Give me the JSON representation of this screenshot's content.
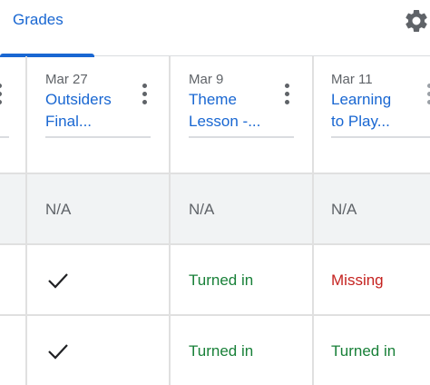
{
  "tab": {
    "label": "Grades"
  },
  "columns": [
    {
      "date": "Mar 27",
      "title_line1": "Outsiders",
      "title_line2": "Final..."
    },
    {
      "date": "Mar 9",
      "title_line1": "Theme",
      "title_line2": "Lesson -..."
    },
    {
      "date": "Mar 11",
      "title_line1": "Learning",
      "title_line2": "to Play..."
    }
  ],
  "class_average_row": [
    "N/A",
    "N/A",
    "N/A"
  ],
  "rows": [
    {
      "cells": [
        "✓",
        "Turned in",
        "Missing"
      ]
    },
    {
      "cells": [
        "✓",
        "Turned in",
        "Turned in"
      ]
    }
  ],
  "colors": {
    "accent": "#1967d2",
    "turned_in": "#188038",
    "missing": "#c5221f"
  },
  "icons": [
    "settings-gear-icon",
    "more-vert-icon",
    "checkmark-icon"
  ]
}
